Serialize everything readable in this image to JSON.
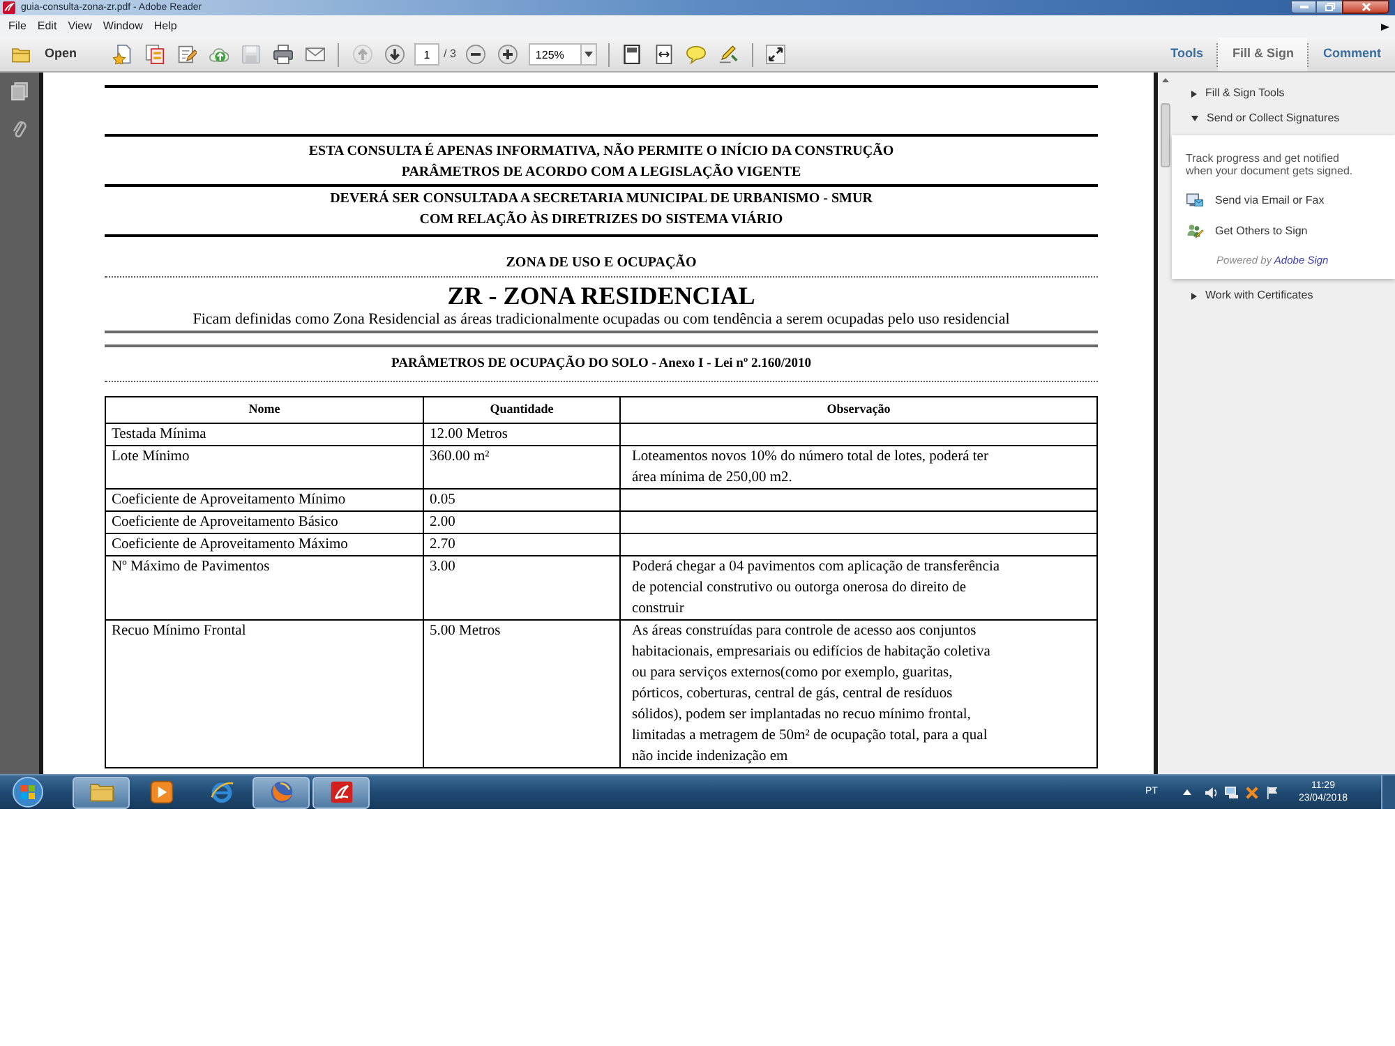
{
  "window": {
    "title": "guia-consulta-zona-zr.pdf - Adobe Reader"
  },
  "menu": [
    "File",
    "Edit",
    "View",
    "Window",
    "Help"
  ],
  "toolbar": {
    "groups": [
      [
        {
          "kind": "open",
          "label": "Open"
        }
      ],
      [
        {
          "kind": "create_pdf",
          "disabled": false
        },
        {
          "kind": "combine",
          "disabled": false
        },
        {
          "kind": "edit",
          "disabled": false
        },
        {
          "kind": "share",
          "disabled": false
        },
        {
          "kind": "save",
          "disabled": true
        },
        {
          "kind": "print",
          "disabled": false
        },
        {
          "kind": "email",
          "disabled": false
        }
      ],
      [
        {
          "kind": "prev_page",
          "disabled": true
        },
        {
          "kind": "next_page",
          "disabled": false
        },
        {
          "kind": "page",
          "value": "1",
          "total": "/ 3"
        },
        {
          "kind": "zoom_out",
          "disabled": false
        },
        {
          "kind": "zoom_in",
          "disabled": false
        },
        {
          "kind": "zoom",
          "value": "125%"
        }
      ],
      [
        {
          "kind": "fit_page",
          "disabled": false
        },
        {
          "kind": "fit_width",
          "disabled": false
        },
        {
          "kind": "comment",
          "disabled": false
        },
        {
          "kind": "sign",
          "disabled": false
        }
      ],
      [
        {
          "kind": "full_screen",
          "disabled": false
        }
      ]
    ],
    "panes": [
      {
        "label": "Tools",
        "selected": false
      },
      {
        "label": "Fill & Sign",
        "selected": true
      },
      {
        "label": "Comment",
        "selected": false
      }
    ]
  },
  "document": {
    "notices": [
      [
        "ESTA CONSULTA É APENAS INFORMATIVA, NÃO PERMITE O INÍCIO DA CONSTRUÇÃO",
        "PARÂMETROS DE ACORDO COM A LEGISLAÇÃO VIGENTE"
      ],
      [
        "DEVERÁ SER CONSULTADA A SECRETARIA MUNICIPAL DE URBANISMO - SMUR",
        "COM RELAÇÃO ÀS DIRETRIZES DO SISTEMA VIÁRIO"
      ]
    ],
    "zone_heading": "ZONA DE USO E OCUPAÇÃO",
    "zone_title": "ZR - ZONA RESIDENCIAL",
    "zone_description": "Ficam definidas como Zona Residencial as áreas tradicionalmente ocupadas ou com tendência a serem ocupadas pelo uso residencial",
    "parameters_heading": "PARÂMETROS DE OCUPAÇÃO DO SOLO - Anexo I - Lei nº 2.160/2010",
    "table": {
      "columns": [
        "Nome",
        "Quantidade",
        "Observação"
      ],
      "rows": [
        {
          "nome": "Testada Mínima",
          "quantidade": "12.00 Metros"
        },
        {
          "nome": "Lote Mínimo",
          "quantidade": "360.00 m²",
          "observacao": "Loteamentos novos 10% do número total de lotes, poderá ter área mínima de 250,00 m2."
        },
        {
          "nome": "Coeficiente de Aproveitamento Mínimo",
          "quantidade": "0.05"
        },
        {
          "nome": "Coeficiente de Aproveitamento Básico",
          "quantidade": "2.00"
        },
        {
          "nome": "Coeficiente de Aproveitamento Máximo",
          "quantidade": "2.70"
        },
        {
          "nome": "Nº Máximo de Pavimentos",
          "quantidade": "3.00",
          "observacao": "Poderá chegar a 04 pavimentos com aplicação de transferência de potencial construtivo ou outorga onerosa do direito de construir"
        },
        {
          "nome": "Recuo Mínimo Frontal",
          "quantidade": "5.00 Metros",
          "observacao": "As áreas construídas para controle de acesso aos conjuntos habitacionais, empresariais ou edifícios de habitação coletiva ou para serviços externos(como por exemplo, guaritas, pórticos, coberturas, central de gás, central de resíduos sólidos), podem ser implantadas no recuo mínimo frontal, limitadas a metragem de 50m² de ocupação total, para a qual não incide indenização em"
        }
      ]
    }
  },
  "side_panel": {
    "sections": [
      {
        "title": "Fill & Sign Tools",
        "expanded": false
      },
      {
        "title": "Send or Collect Signatures",
        "expanded": true,
        "description": "Track progress and get notified when your document gets signed.",
        "actions": [
          {
            "kind": "email",
            "label": "Send via Email or Fax"
          },
          {
            "kind": "sign",
            "label": "Get Others to Sign"
          }
        ],
        "powered_by": "Powered by",
        "link": "Adobe Sign"
      },
      {
        "title": "Work with Certificates",
        "expanded": false
      }
    ]
  },
  "taskbar": {
    "apps": [
      {
        "kind": "explorer",
        "running": true
      },
      {
        "kind": "media_player",
        "running": false
      },
      {
        "kind": "browser_e",
        "running": false
      },
      {
        "kind": "browser_globe",
        "running": true
      },
      {
        "kind": "reader",
        "running": true
      }
    ],
    "language": "PT",
    "time": "11:29",
    "date": "23/04/2018"
  }
}
